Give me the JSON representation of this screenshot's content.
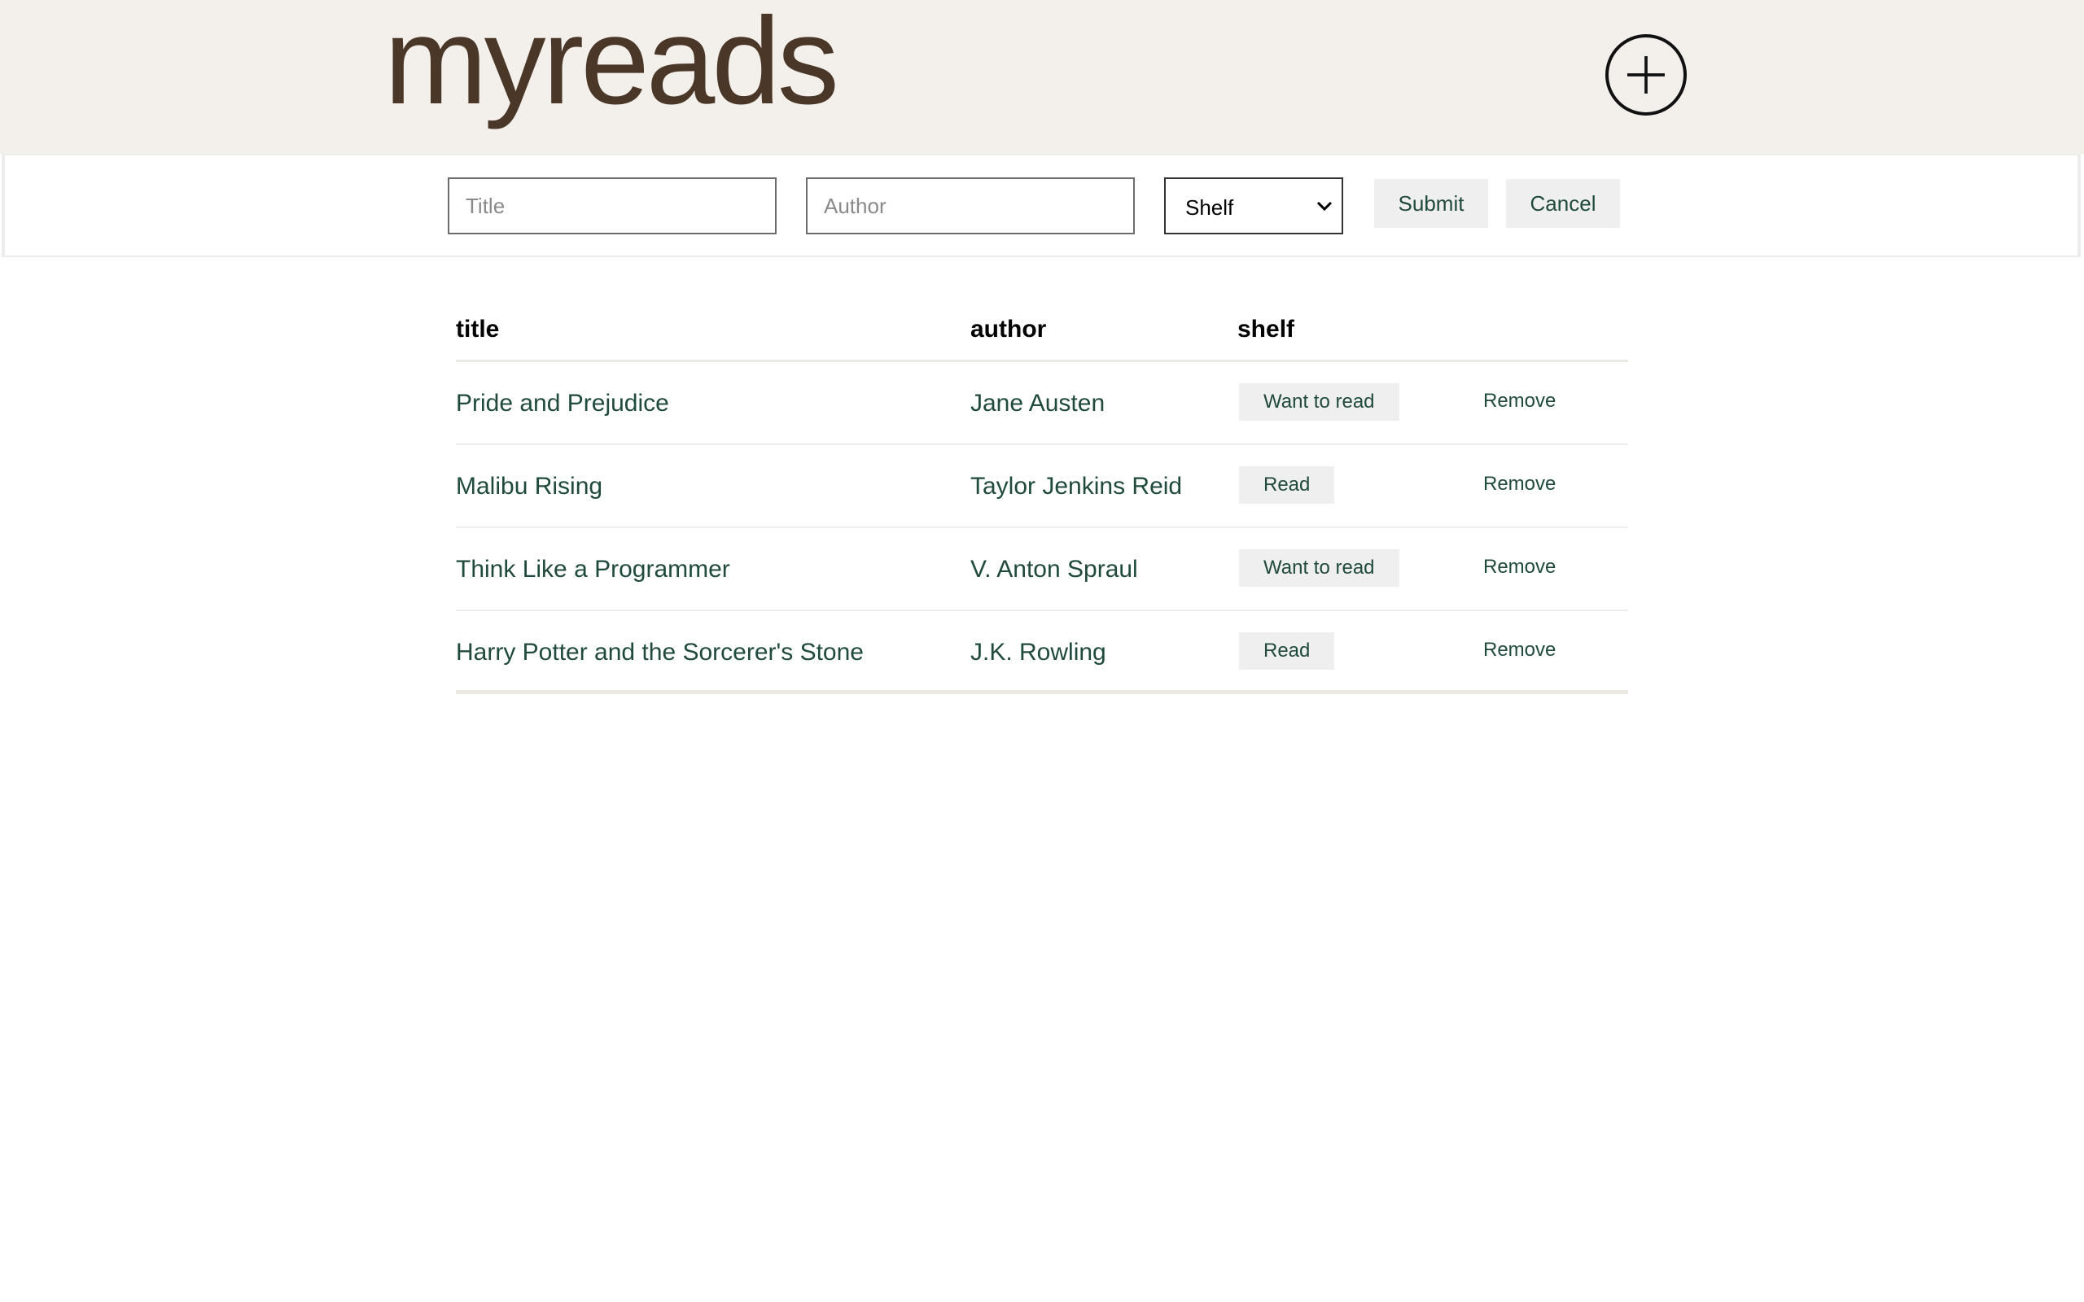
{
  "header": {
    "logo_my": "my",
    "logo_reads": "reads",
    "add_icon": "plus-circle-icon"
  },
  "form": {
    "title_placeholder": "Title",
    "author_placeholder": "Author",
    "shelf_selected": "Shelf",
    "submit_label": "Submit",
    "cancel_label": "Cancel"
  },
  "table": {
    "columns": [
      "title",
      "author",
      "shelf"
    ],
    "remove_label": "Remove",
    "rows": [
      {
        "title": "Pride and Prejudice",
        "author": "Jane Austen",
        "shelf": "Want to read"
      },
      {
        "title": "Malibu Rising",
        "author": "Taylor Jenkins Reid",
        "shelf": "Read"
      },
      {
        "title": "Think Like a Programmer",
        "author": "V. Anton Spraul",
        "shelf": "Want to read"
      },
      {
        "title": "Harry Potter and the Sorcerer's Stone",
        "author": "J.K. Rowling",
        "shelf": "Read"
      }
    ]
  },
  "colors": {
    "header_bg": "#f3f0ec",
    "logo": "#4a3727",
    "link_text": "#1f4a3d",
    "button_bg": "#efefef"
  }
}
